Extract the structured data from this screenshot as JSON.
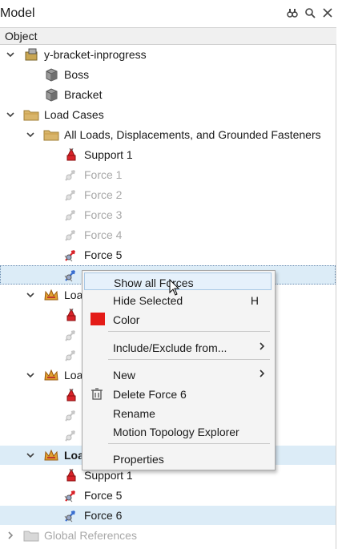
{
  "panel": {
    "title": "Model",
    "column_header": "Object"
  },
  "toolbar_icons": [
    "binoculars-icon",
    "search-icon",
    "close-icon"
  ],
  "tree": {
    "model": "y-bracket-inprogress",
    "parts": [
      "Boss",
      "Bracket"
    ],
    "load_cases": "Load Cases",
    "all_loads": "All Loads, Displacements, and Grounded Fasteners",
    "all_loads_children": [
      "Support 1",
      "Force 1",
      "Force 2",
      "Force 3",
      "Force 4",
      "Force 5"
    ],
    "lc_a": "Loa",
    "lc_b": "Loa",
    "lc_c": "Loa",
    "lc_c_children": [
      "Support 1",
      "Force 5",
      "Force 6"
    ],
    "global_refs": "Global References"
  },
  "context_menu": {
    "items": {
      "show_all": "Show all Forces",
      "hide_selected": "Hide Selected",
      "hide_shortcut": "H",
      "color": "Color",
      "include_exclude": "Include/Exclude from...",
      "new": "New",
      "delete": "Delete Force 6",
      "rename": "Rename",
      "motion": "Motion Topology Explorer",
      "properties": "Properties"
    },
    "color_swatch": "#e41b17"
  },
  "colors": {
    "selection": "#dcecf7",
    "dimmed_text": "#a8a8a8",
    "support_red": "#d9232a"
  }
}
